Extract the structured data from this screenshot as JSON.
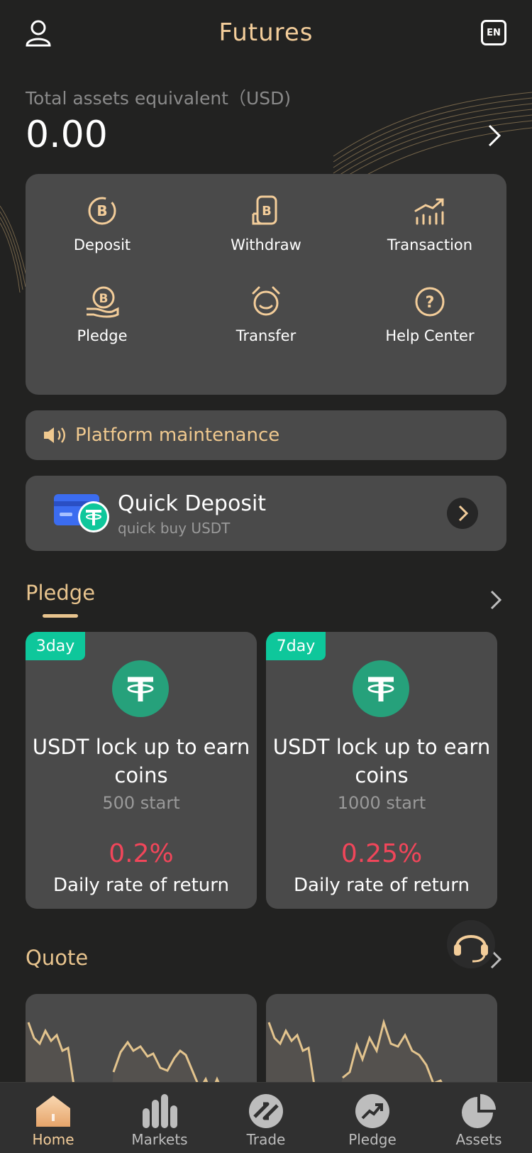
{
  "header": {
    "title": "Futures",
    "lang_badge": "EN",
    "user_icon": "user-icon"
  },
  "assets": {
    "label": "Total assets equivalent（USD)",
    "value": "0.00"
  },
  "actions": [
    {
      "label": "Deposit",
      "icon": "deposit-bitcoin-icon"
    },
    {
      "label": "Withdraw",
      "icon": "withdraw-bitcoin-icon"
    },
    {
      "label": "Transaction",
      "icon": "chart-trend-icon"
    },
    {
      "label": "Pledge",
      "icon": "pledge-hand-icon"
    },
    {
      "label": "Transfer",
      "icon": "transfer-alarm-icon"
    },
    {
      "label": "Help Center",
      "icon": "question-icon"
    }
  ],
  "notice": {
    "text": "Platform maintenance"
  },
  "quick_deposit": {
    "title": "Quick Deposit",
    "subtitle": "quick buy USDT"
  },
  "pledge_section": {
    "title": "Pledge",
    "cards": [
      {
        "tag": "3day",
        "title": "USDT lock up to earn coins",
        "start": "500 start",
        "rate": "0.2%",
        "rate_label": "Daily rate of return"
      },
      {
        "tag": "7day",
        "title": "USDT lock up to earn coins",
        "start": "1000 start",
        "rate": "0.25%",
        "rate_label": "Daily rate of return"
      }
    ]
  },
  "quote_section": {
    "title": "Quote"
  },
  "tabbar": [
    {
      "label": "Home",
      "icon": "home-icon",
      "active": true
    },
    {
      "label": "Markets",
      "icon": "markets-bars-icon",
      "active": false
    },
    {
      "label": "Trade",
      "icon": "trade-icon",
      "active": false
    },
    {
      "label": "Pledge",
      "icon": "pledge-trend-icon",
      "active": false
    },
    {
      "label": "Assets",
      "icon": "pie-icon",
      "active": false
    }
  ],
  "colors": {
    "background": "#222221",
    "card": "#4a4a4a",
    "gold": "#f3cd9a",
    "accent_green": "#0ec79b",
    "rate_red": "#f1465a",
    "usdt_green": "#26a17b"
  }
}
